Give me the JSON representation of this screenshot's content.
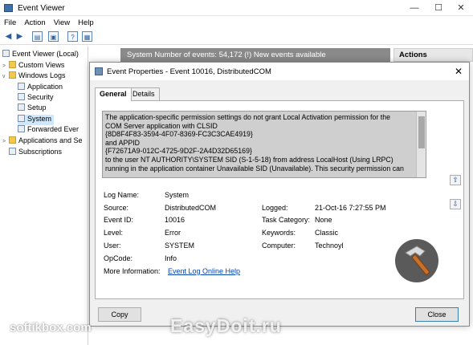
{
  "window": {
    "title": "Event Viewer",
    "minimize": "—",
    "maximize": "☐",
    "close": "✕"
  },
  "menu": [
    "File",
    "Action",
    "View",
    "Help"
  ],
  "tree": [
    {
      "label": "Event Viewer (Local)",
      "twisty": ""
    },
    {
      "label": "Custom Views",
      "twisty": ">"
    },
    {
      "label": "Windows Logs",
      "twisty": "v"
    },
    {
      "label": "Application",
      "twisty": ""
    },
    {
      "label": "Security",
      "twisty": ""
    },
    {
      "label": "Setup",
      "twisty": ""
    },
    {
      "label": "System",
      "twisty": ""
    },
    {
      "label": "Forwarded Ever",
      "twisty": ""
    },
    {
      "label": "Applications and Se",
      "twisty": ">"
    },
    {
      "label": "Subscriptions",
      "twisty": ""
    }
  ],
  "center_header": "System    Number of events: 54,172 (!) New events available",
  "actions_header": "Actions",
  "dialog": {
    "title": "Event Properties - Event 10016, DistributedCOM",
    "close": "✕",
    "tabs": [
      "General",
      "Details"
    ],
    "description": [
      "The application-specific permission settings do not grant Local Activation permission for the",
      "COM Server application with CLSID",
      "{8D8F4F83-3594-4F07-8369-FC3C3CAE4919}",
      " and APPID",
      "{F72671A9-012C-4725-9D2F-2A4D32D65169}",
      " to the user NT AUTHORITY\\SYSTEM SID (S-1-5-18) from address LocalHost (Using LRPC)",
      "running in the application container Unavailable SID (Unavailable). This security permission can"
    ],
    "up_arrow": "⇧",
    "down_arrow": "⇩",
    "fields": {
      "log_name_label": "Log Name:",
      "log_name": "System",
      "source_label": "Source:",
      "source": "DistributedCOM",
      "logged_label": "Logged:",
      "logged": "21-Oct-16 7:27:55 PM",
      "event_id_label": "Event ID:",
      "event_id": "10016",
      "task_category_label": "Task Category:",
      "task_category": "None",
      "level_label": "Level:",
      "level": "Error",
      "keywords_label": "Keywords:",
      "keywords": "Classic",
      "user_label": "User:",
      "user": "SYSTEM",
      "computer_label": "Computer:",
      "computer": "Technoyl",
      "opcode_label": "OpCode:",
      "opcode": "Info",
      "more_info_label": "More Information:",
      "more_info_link": "Event Log Online Help"
    },
    "copy_button": "Copy",
    "close_button": "Close"
  },
  "watermarks": {
    "left": "softikbox.com",
    "center": "EasyDoit.ru"
  },
  "colors": {
    "center_header_bg": "#8a8a8a",
    "selection": "#cde8ff",
    "description_bg": "#cfcfcf",
    "link": "#0645ad"
  }
}
